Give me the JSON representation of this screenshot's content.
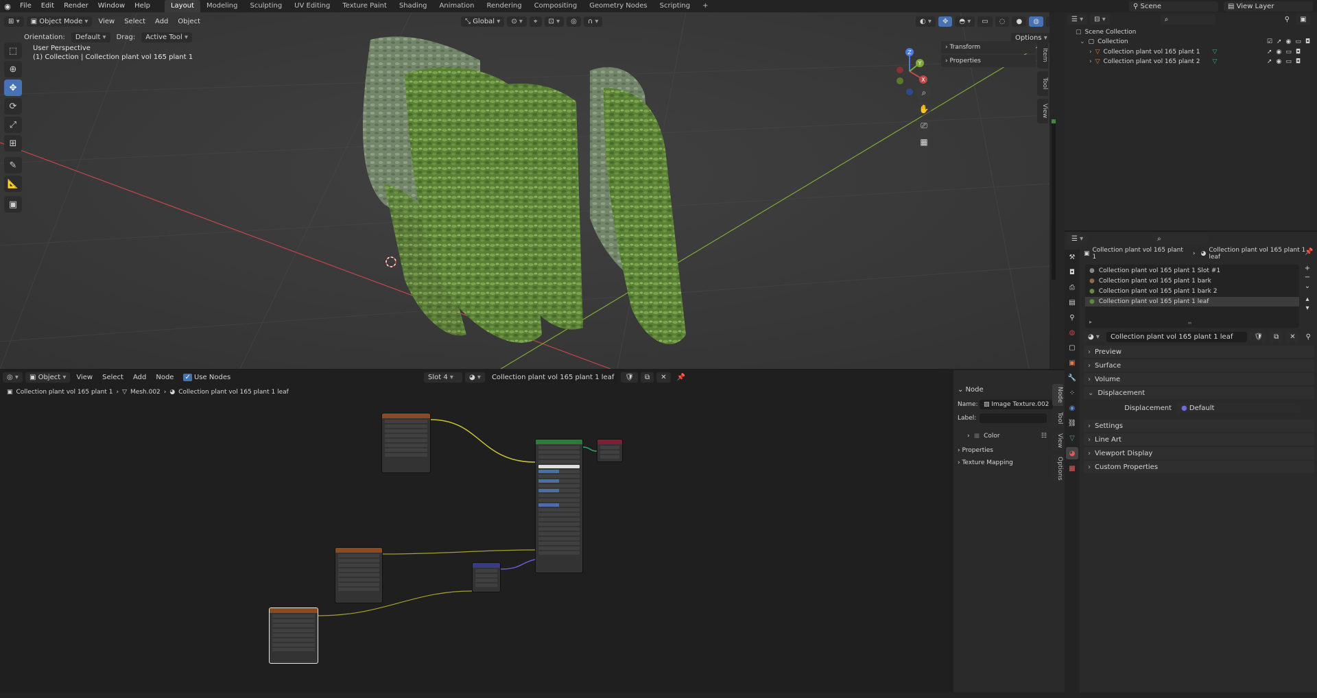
{
  "menu": {
    "items": [
      "File",
      "Edit",
      "Render",
      "Window",
      "Help"
    ],
    "workspaces": [
      "Layout",
      "Modeling",
      "Sculpting",
      "UV Editing",
      "Texture Paint",
      "Shading",
      "Animation",
      "Rendering",
      "Compositing",
      "Geometry Nodes",
      "Scripting"
    ],
    "active_workspace": "Layout",
    "scene": "Scene",
    "view_layer": "View Layer"
  },
  "viewport": {
    "mode": "Object Mode",
    "menus": [
      "View",
      "Select",
      "Add",
      "Object"
    ],
    "transform_orientation": "Global",
    "orientation_label": "Orientation:",
    "orientation_value": "Default",
    "drag_label": "Drag:",
    "drag_value": "Active Tool",
    "options": "Options",
    "overlay_title": "User Perspective",
    "overlay_subtitle": "(1) Collection | Collection plant vol 165 plant 1",
    "npanel": {
      "transform": "Transform",
      "properties": "Properties"
    },
    "side_tabs": [
      "Item",
      "Tool",
      "View"
    ],
    "gizmo": {
      "x": "X",
      "y": "Y",
      "z": "Z"
    }
  },
  "outliner": {
    "root": "Scene Collection",
    "collection": "Collection",
    "objects": [
      "Collection plant vol 165 plant 1",
      "Collection plant vol 165 plant 2"
    ]
  },
  "properties": {
    "breadcrumb_object": "Collection plant vol 165 plant 1",
    "breadcrumb_material": "Collection plant vol 165 plant 1 leaf",
    "material_slots": [
      "Collection plant vol 165 plant 1 Slot #1",
      "Collection plant vol 165 plant 1 bark",
      "Collection plant vol 165 plant 1 bark 2",
      "Collection plant vol 165 plant 1 leaf"
    ],
    "active_material": "Collection plant vol 165 plant 1 leaf",
    "panels": [
      "Preview",
      "Surface",
      "Volume",
      "Displacement",
      "Settings",
      "Line Art",
      "Viewport Display",
      "Custom Properties"
    ],
    "displacement_label": "Displacement",
    "displacement_value": "Default"
  },
  "node_editor": {
    "type": "Object",
    "menus": [
      "View",
      "Select",
      "Add",
      "Node"
    ],
    "use_nodes": "Use Nodes",
    "slot": "Slot 4",
    "material": "Collection plant vol 165 plant 1 leaf",
    "breadcrumb": [
      "Collection plant vol 165 plant 1",
      "Mesh.002",
      "Collection plant vol 165 plant 1 leaf"
    ],
    "side": {
      "section": "Node",
      "name_label": "Name:",
      "name_value": "Image Texture.002",
      "label_label": "Label:",
      "color": "Color",
      "properties": "Properties",
      "texture_mapping": "Texture Mapping",
      "tabs": [
        "Node",
        "Tool",
        "View",
        "Options"
      ]
    }
  },
  "colors": {
    "accent": "#4772b3",
    "image_texture_header": "#8a4a22",
    "principled_header": "#2f7a3a",
    "output_header": "#7a2233",
    "normal_map_header": "#3a3a8a",
    "link_yellow": "#c9c23a",
    "link_purple": "#6a5acd",
    "x_axis": "#c24848",
    "y_axis": "#7ea83a",
    "foliage": "#5f8a3a"
  }
}
